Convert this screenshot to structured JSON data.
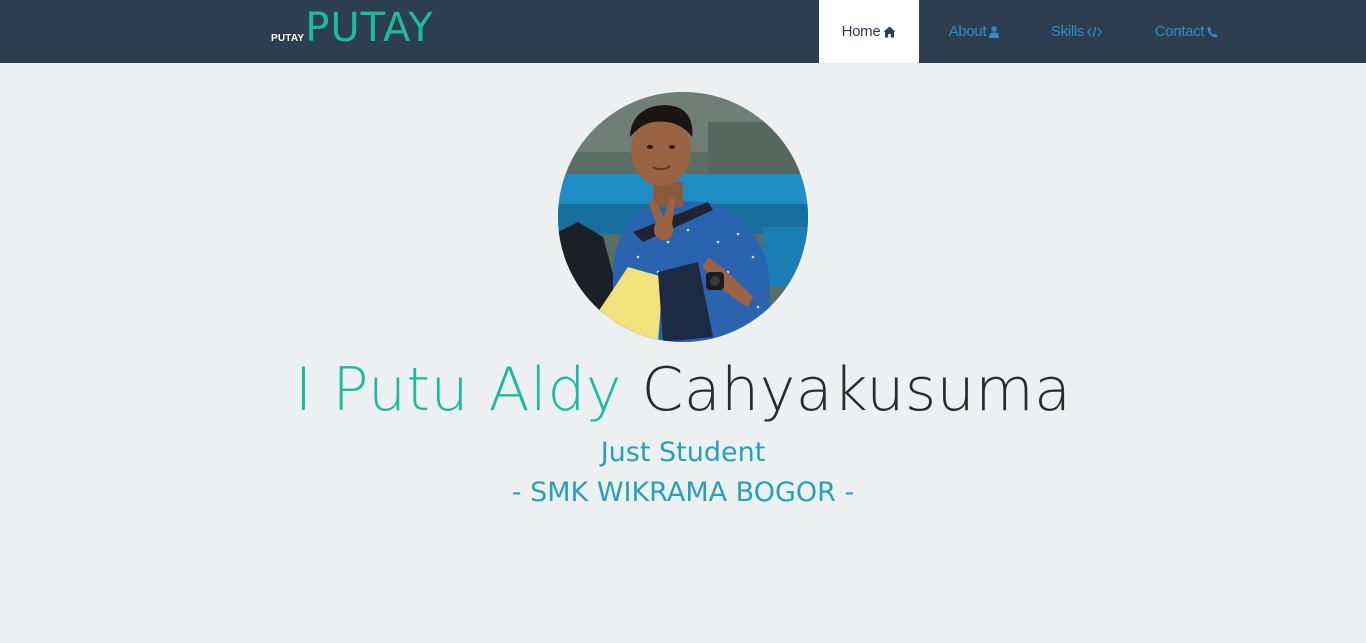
{
  "brand": {
    "small": "PUTAY",
    "big": "PUTAY"
  },
  "nav": {
    "items": [
      {
        "label": "Home",
        "icon": "home-icon",
        "active": true
      },
      {
        "label": "About",
        "icon": "user-icon",
        "active": false
      },
      {
        "label": "Skills",
        "icon": "code-icon",
        "active": false
      },
      {
        "label": "Contact",
        "icon": "phone-icon",
        "active": false
      }
    ]
  },
  "hero": {
    "avatar_icon": "profile-photo",
    "first_name": "I Putu Aldy",
    "last_name": "Cahyakusuma",
    "tagline": "Just Student",
    "school": "- SMK WIKRAMA BOGOR -"
  },
  "colors": {
    "navbar": "#2c3e50",
    "accent": "#1abc9c",
    "link": "#2f8ec9",
    "subtitle": "#27a1b8",
    "background": "#ecf0f1"
  }
}
